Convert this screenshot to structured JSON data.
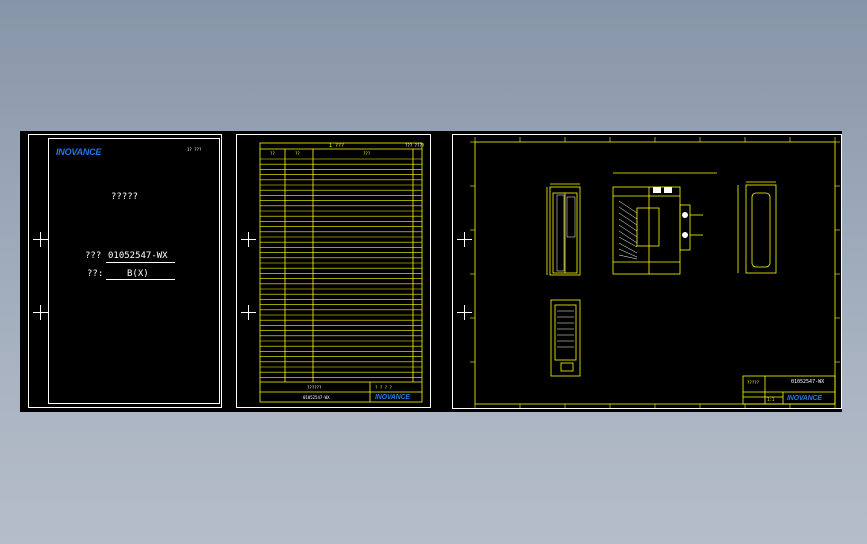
{
  "colors": {
    "background": "#000000",
    "sheet_border": "#ffffff",
    "drawing_lines": "#ffff00",
    "brand_blue": "#1e78e6",
    "text": "#ffffff"
  },
  "cover_sheet": {
    "brand_logo": "INOVANCE",
    "corner_text": "1?  ???",
    "title": "?????",
    "part_no_label": "???",
    "part_no_value": "01052547-WX",
    "version_label": "??:",
    "version_value": "B(X)"
  },
  "revision_sheet": {
    "header_title": "1  ???",
    "header_right": "???  ????",
    "column_headers": [
      "??",
      "??",
      "???"
    ],
    "footer_title": "??????",
    "footer_part_no": "01052547-WX",
    "footer_page": "? ?  ? ?",
    "brand_logo": "INOVANCE"
  },
  "drawing_sheet": {
    "title_block_label": "?????",
    "part_no": "01052547-WX",
    "brand_logo": "INOVANCE",
    "scale_text": "1:1"
  }
}
